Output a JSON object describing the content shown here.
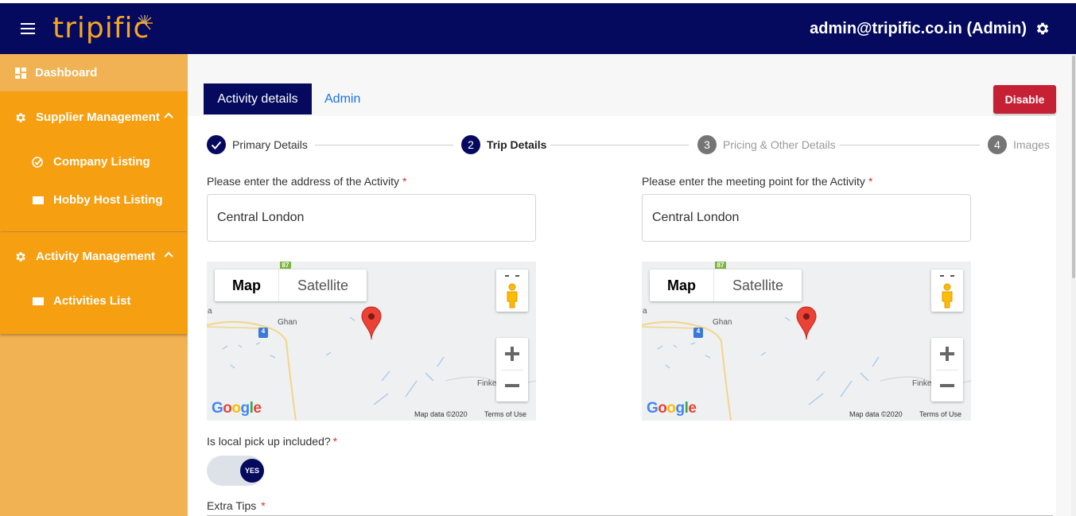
{
  "header": {
    "logo_text": "tripific",
    "user_label": "admin@tripific.co.in (Admin)"
  },
  "sidebar": {
    "dashboard": "Dashboard",
    "supplier_management": "Supplier Management",
    "company_listing": "Company Listing",
    "hobby_host_listing": "Hobby Host Listing",
    "activity_management": "Activity Management",
    "activities_list": "Activities List"
  },
  "tabs": {
    "activity_details": "Activity details",
    "admin": "Admin"
  },
  "disable_label": "Disable",
  "stepper": [
    {
      "number": "",
      "label": "Primary Details",
      "state": "done"
    },
    {
      "number": "2",
      "label": "Trip Details",
      "state": "active"
    },
    {
      "number": "3",
      "label": "Pricing & Other Details",
      "state": "pending"
    },
    {
      "number": "4",
      "label": "Images",
      "state": "pending"
    }
  ],
  "address_field": {
    "label": "Please enter the address of the Activity",
    "value": "Central London"
  },
  "meeting_field": {
    "label": "Please enter the meeting point for the Activity",
    "value": "Central London"
  },
  "required_mark": "*",
  "map": {
    "type_map": "Map",
    "type_satellite": "Satellite",
    "zoom_in": "+",
    "zoom_out": "−",
    "google": "Google",
    "map_data": "Map data ©2020",
    "terms": "Terms of Use",
    "hwy_87": "87",
    "hwy_4": "4",
    "town_ghan": "Ghan",
    "town_finke": "Finke",
    "edge_letter": "a"
  },
  "pickup": {
    "label": "Is local pick up included?",
    "toggle_value": "YES"
  },
  "extra_tips": {
    "label": "Extra Tips"
  },
  "colors": {
    "navy": "#050a5e",
    "orange": "#f59f11",
    "orange_light": "#f0b252",
    "red": "#c62035",
    "link": "#1a73e8"
  }
}
